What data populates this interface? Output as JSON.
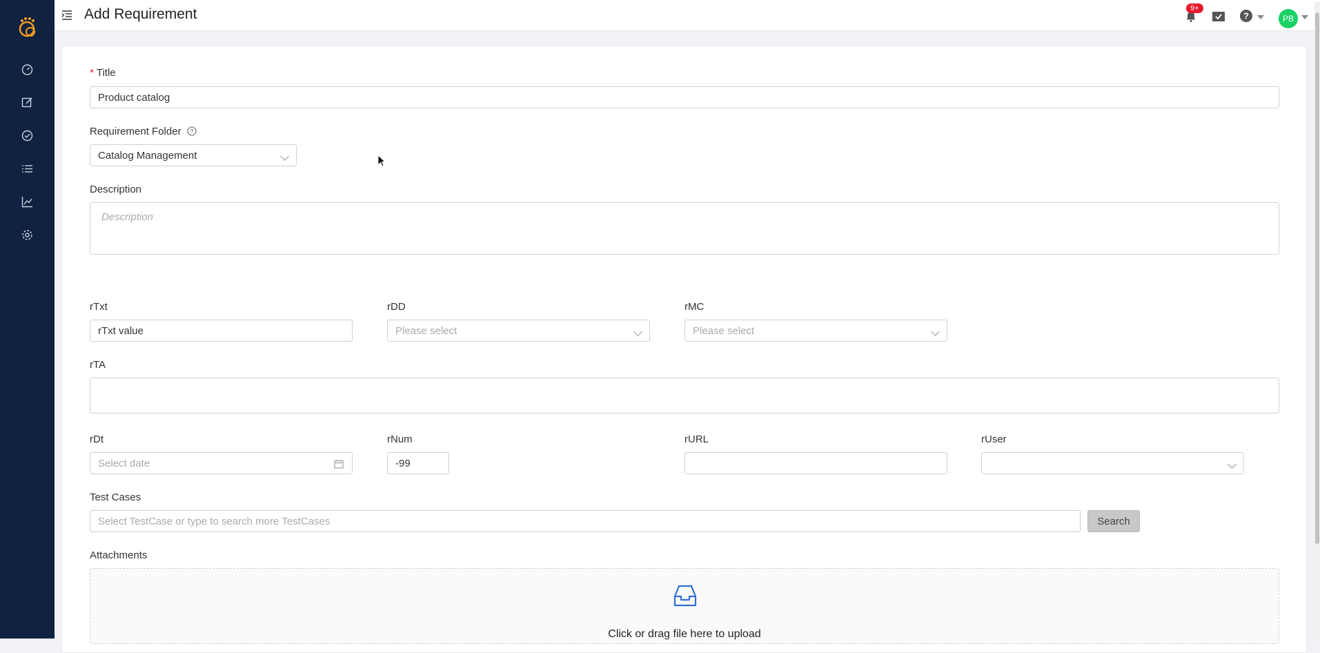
{
  "header": {
    "title": "Add Requirement",
    "notification_badge": "9+",
    "avatar_initials": "PB"
  },
  "sidebar": {
    "items": [
      {
        "name": "dashboard-icon"
      },
      {
        "name": "edit-icon"
      },
      {
        "name": "check-circle-icon"
      },
      {
        "name": "list-icon"
      },
      {
        "name": "chart-icon"
      },
      {
        "name": "gear-icon"
      }
    ]
  },
  "form": {
    "title_label": "Title",
    "title_value": "Product catalog",
    "folder_label": "Requirement Folder",
    "folder_value": "Catalog Management",
    "description_label": "Description",
    "description_placeholder": "Description",
    "rtxt_label": "rTxt",
    "rtxt_value": "rTxt value",
    "rdd_label": "rDD",
    "rdd_placeholder": "Please select",
    "rmc_label": "rMC",
    "rmc_placeholder": "Please select",
    "rta_label": "rTA",
    "rdt_label": "rDt",
    "rdt_placeholder": "Select date",
    "rnum_label": "rNum",
    "rnum_value": "-99",
    "rurl_label": "rURL",
    "ruser_label": "rUser",
    "testcases_label": "Test Cases",
    "testcases_placeholder": "Select TestCase or type to search more TestCases",
    "search_label": "Search",
    "attachments_label": "Attachments",
    "upload_text": "Click or drag file here to upload"
  },
  "colors": {
    "sidebar": "#0f2240",
    "accent_required": "#e8192c",
    "avatar": "#1ad165"
  }
}
